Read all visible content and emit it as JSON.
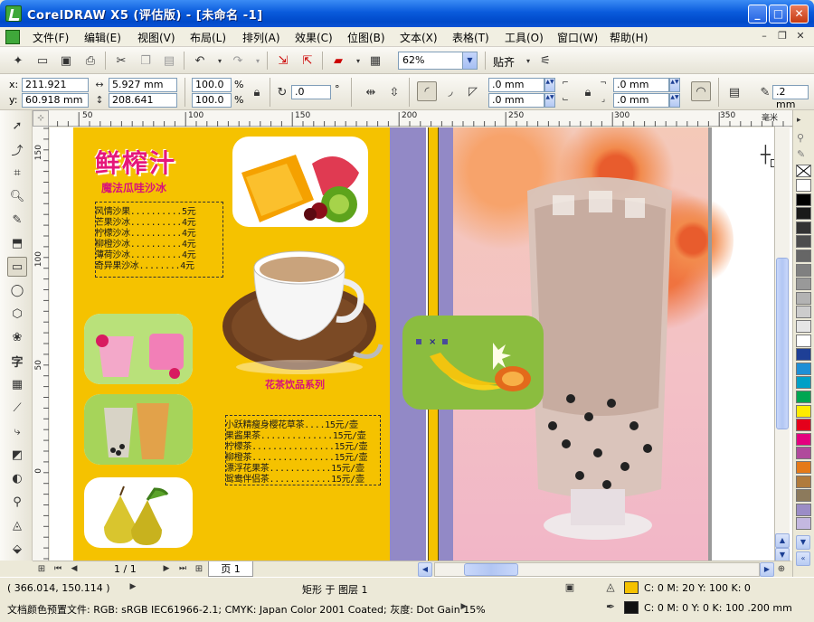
{
  "window": {
    "title": "CorelDRAW X5 (评估版) - [未命名 -1]",
    "buttons": {
      "minimize": "_",
      "maximize": "□",
      "close": "✕"
    }
  },
  "menu": {
    "items": [
      "文件(F)",
      "编辑(E)",
      "视图(V)",
      "布局(L)",
      "排列(A)",
      "效果(C)",
      "位图(B)",
      "文本(X)",
      "表格(T)",
      "工具(O)",
      "窗口(W)",
      "帮助(H)"
    ],
    "mdi": {
      "minimize": "–",
      "restore": "❐",
      "close": "✕"
    }
  },
  "toolbar": {
    "zoom": "62%",
    "snap_label": "贴齐"
  },
  "property_bar": {
    "x_label": "x:",
    "x_value": "211.921 mm",
    "y_label": "y:",
    "y_value": "60.918 mm",
    "width_value": "5.927 mm",
    "height_value": "208.641 mm",
    "scale_x": "100.0",
    "scale_y": "100.0",
    "percent": "%",
    "rotation": ".0",
    "degree": "°",
    "corner_tl": ".0 mm",
    "corner_bl": ".0 mm",
    "corner_tr": ".0 mm",
    "corner_br": ".0 mm",
    "outline_width": ".2 mm"
  },
  "ruler": {
    "corner": "⊹",
    "h_ticks": [
      "50",
      "100",
      "150",
      "200",
      "250",
      "300",
      "350"
    ],
    "v_ticks": [
      "150",
      "100",
      "50",
      "0"
    ],
    "unit": "毫米"
  },
  "artwork": {
    "title": "鲜榨汁",
    "subtitle": "魔法瓜哇沙冰",
    "menu1": [
      "风情沙果..........5元",
      "芒果沙冰..........4元",
      "柠檬沙冰..........4元",
      "柳橙沙冰..........4元",
      "薄荷沙冰..........4元",
      "奇异果沙冰........4元"
    ],
    "section_title": "花茶饮品系列",
    "menu2": [
      "小跃精瘦身樱花草茶....15元/壶",
      "果酱果茶..............15元/壶",
      "柠檬茶................15元/壶",
      "柳橙茶................15元/壶",
      "漂浮花果茶............15元/壶",
      "鸳鸯伴侣茶............15元/壶"
    ]
  },
  "navigator": {
    "page_count": "1 / 1",
    "page_tab": "页 1"
  },
  "status": {
    "coords": "( 366.014, 150.114 )",
    "object_info": "矩形 于 图层 1",
    "color_profile": "文档颜色预置文件: RGB: sRGB IEC61966-2.1; CMYK: Japan Color 2001 Coated; 灰度: Dot Gain 15%",
    "fill_info": "C: 0 M: 20 Y: 100 K: 0",
    "outline_info": "C: 0 M: 0 Y: 0 K: 100  .200 mm",
    "fill_color": "#f5c200",
    "outline_color": "#111111"
  },
  "palette": [
    "#ffffff",
    "#000000",
    "#1a1a1a",
    "#333333",
    "#4d4d4d",
    "#666666",
    "#808080",
    "#999999",
    "#b3b3b3",
    "#cccccc",
    "#e6e6e6",
    "#ffffff",
    "#1e3f96",
    "#1e8fd6",
    "#00a0c6",
    "#00a651",
    "#ffec00",
    "#e4001b",
    "#e4007f",
    "#b04a9c",
    "#e57a18",
    "#b07b3c",
    "#8c7a5c",
    "#9b8dc6",
    "#c4b8e0"
  ]
}
